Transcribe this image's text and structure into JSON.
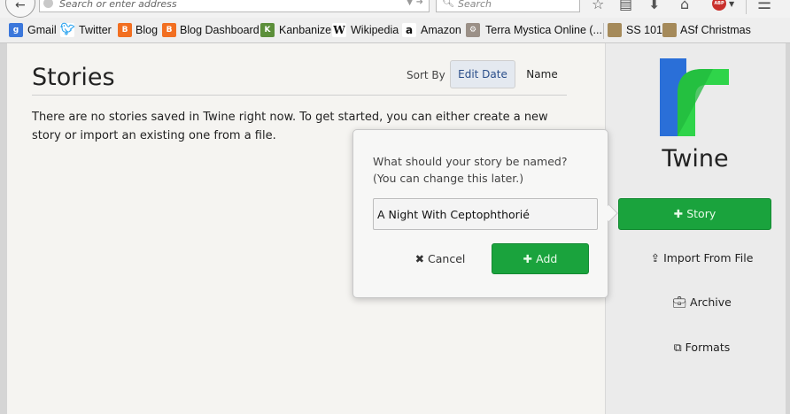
{
  "browser": {
    "back_symbol": "←",
    "url_placeholder": "Search or enter address",
    "search_placeholder": "Search",
    "abp_label": "ABP"
  },
  "bookmarks": [
    {
      "label": "Gmail",
      "icon": "google-icon"
    },
    {
      "label": "Twitter",
      "icon": "twitter-bird-icon"
    },
    {
      "label": "Blog",
      "icon": "blogger-icon"
    },
    {
      "label": "Blog Dashboard",
      "icon": "blogger-icon"
    },
    {
      "label": "Kanbanize",
      "icon": "kanbanize-icon"
    },
    {
      "label": "Wikipedia",
      "icon": "wikipedia-icon"
    },
    {
      "label": "Amazon",
      "icon": "amazon-icon"
    },
    {
      "label": "Terra Mystica Online (...",
      "icon": "terra-mystica-icon"
    },
    {
      "label": "SS 101",
      "icon": "folder-bookmark-icon"
    },
    {
      "label": "ASf Christmas",
      "icon": "folder-bookmark-icon"
    }
  ],
  "stories": {
    "title": "Stories",
    "sort_label": "Sort By",
    "sort_options": [
      "Edit Date",
      "Name"
    ],
    "sort_selected": "Edit Date",
    "empty_message": "There are no stories saved in Twine right now. To get started, you can either create a new story or import an existing one from a file."
  },
  "new_story_popup": {
    "prompt_line1": "What should your story be named?",
    "prompt_line2": "(You can change this later.)",
    "story_name_value": "A Night With Ceptophthorié",
    "cancel_label": "Cancel",
    "add_label": "Add"
  },
  "sidebar": {
    "app_name": "Twine",
    "new_story_label": "Story",
    "import_label": "Import From File",
    "archive_label": "Archive",
    "formats_label": "Formats"
  },
  "colors": {
    "accent_green": "#1aa33d",
    "selected_sort_text": "#2a4e8a",
    "logo_blue": "#2a6fd8",
    "logo_green": "#2fd44a"
  }
}
